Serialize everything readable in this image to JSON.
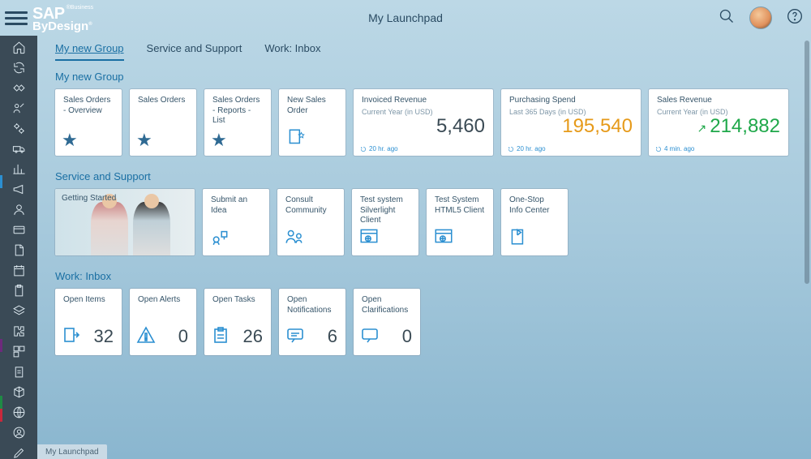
{
  "header": {
    "title": "My Launchpad"
  },
  "tabs": [
    {
      "label": "My new Group",
      "active": true
    },
    {
      "label": "Service and Support"
    },
    {
      "label": "Work: Inbox"
    }
  ],
  "groups": {
    "myNew": {
      "title": "My new Group",
      "tiles": {
        "so_overview": "Sales Orders - Overview",
        "so": "Sales Orders",
        "so_reports": "Sales Orders - Reports - List",
        "new_so": "New Sales Order",
        "rev": {
          "title": "Invoiced Revenue",
          "sub": "Current Year (in USD)",
          "value": "5,460",
          "foot": "20 hr. ago"
        },
        "spend": {
          "title": "Purchasing Spend",
          "sub": "Last 365 Days (in USD)",
          "value": "195,540",
          "foot": "20 hr. ago"
        },
        "sales": {
          "title": "Sales Revenue",
          "sub": "Current Year (in USD)",
          "value": "214,882",
          "foot": "4 min. ago"
        }
      }
    },
    "svc": {
      "title": "Service and Support",
      "tiles": {
        "gs": "Getting Started",
        "idea": "Submit an Idea",
        "cc": "Consult Community",
        "sl": "Test system Silverlight Client",
        "h5": "Test System HTML5 Client",
        "info": "One-Stop Info Center"
      }
    },
    "inbox": {
      "title": "Work: Inbox",
      "tiles": {
        "items": {
          "label": "Open Items",
          "count": "32"
        },
        "alerts": {
          "label": "Open Alerts",
          "count": "0"
        },
        "tasks": {
          "label": "Open Tasks",
          "count": "26"
        },
        "notif": {
          "label": "Open Notifications",
          "count": "6"
        },
        "clar": {
          "label": "Open Clarifications",
          "count": "0"
        }
      }
    }
  },
  "footer": "My Launchpad"
}
